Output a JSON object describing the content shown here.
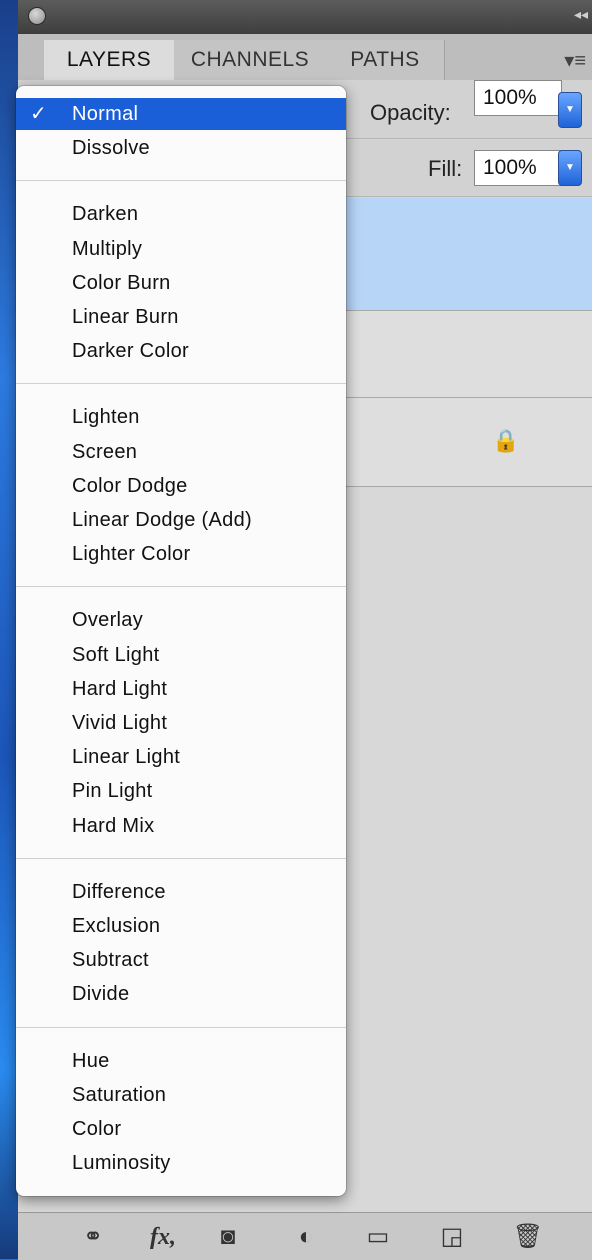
{
  "tabs": [
    "LAYERS",
    "CHANNELS",
    "PATHS"
  ],
  "options": {
    "opacity_label": "Opacity:",
    "opacity_value": "100%",
    "fill_label": "Fill:",
    "fill_value": "100%"
  },
  "blend_menu": {
    "selected": "Normal",
    "groups": [
      [
        "Normal",
        "Dissolve"
      ],
      [
        "Darken",
        "Multiply",
        "Color Burn",
        "Linear Burn",
        "Darker Color"
      ],
      [
        "Lighten",
        "Screen",
        "Color Dodge",
        "Linear Dodge (Add)",
        "Lighter Color"
      ],
      [
        "Overlay",
        "Soft Light",
        "Hard Light",
        "Vivid Light",
        "Linear Light",
        "Pin Light",
        "Hard Mix"
      ],
      [
        "Difference",
        "Exclusion",
        "Subtract",
        "Divide"
      ],
      [
        "Hue",
        "Saturation",
        "Color",
        "Luminosity"
      ]
    ]
  },
  "icons": {
    "check": "checkmark-icon",
    "lock": "lock-icon",
    "link": "link-layers-icon",
    "fx": "fx-icon",
    "mask": "add-mask-icon",
    "adjustment": "adjustment-layer-icon",
    "group": "new-group-icon",
    "new_layer": "new-layer-icon",
    "trash": "trash-icon",
    "panel_menu": "panel-menu-icon"
  },
  "colors": {
    "selection": "#1a5ed8",
    "selected_layer": "#b7d5f7"
  }
}
